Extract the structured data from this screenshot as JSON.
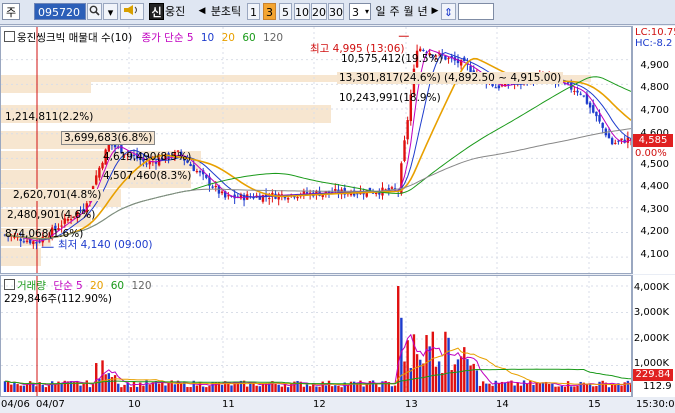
{
  "toolbar": {
    "market_select": "주",
    "stock_code": "095720",
    "stock_name": "웅진",
    "new_label": "신",
    "prev_label": "◀",
    "interval_label": "분초틱",
    "interval_options": [
      "1",
      "3",
      "5",
      "10",
      "20",
      "30"
    ],
    "selected_interval": "3",
    "count_value": "3",
    "period_labels": [
      "일",
      "주",
      "월",
      "년"
    ],
    "next_label": "▶",
    "spin_label": "⇕"
  },
  "price_panel": {
    "legend": {
      "title": "웅진씽크빅 매물대 수(10)",
      "ma_label": "종가 단순",
      "ma_periods": [
        "5",
        "10",
        "20",
        "60",
        "120"
      ],
      "ma_colors": [
        "#c000c0",
        "#1e3ccd",
        "#e8a000",
        "#1a9a1a",
        "#666666"
      ]
    },
    "lc_label": "LC:10.75",
    "hc_label": "HC:-8.2",
    "current_price": "4,585",
    "change_pct": "0.00%",
    "price_axis": [
      "4,900",
      "4,800",
      "4,700",
      "4,600",
      "4,500",
      "4,400",
      "4,300",
      "4,200",
      "4,100"
    ],
    "volume_profile": [
      {
        "text": "10,575,412(19.5%)"
      },
      {
        "text": "13,301,817(24.6%) (4,892.50 ~ 4,915.00)"
      },
      {
        "text": "10,243,991(18.9%)"
      },
      {
        "text": "1,214,811(2.2%)"
      },
      {
        "text": "3,699,683(6.8%)"
      },
      {
        "text": "4,619,490(8.5%)"
      },
      {
        "text": "4,507,460(8.3%)"
      },
      {
        "text": "2,620,701(4.8%)"
      },
      {
        "text": "2,480,901(4.6%)"
      },
      {
        "text": "874,068(1.6%)"
      }
    ],
    "high_label": "최고 4,995 (13:06)",
    "low_label": "최저 4,140 (09:00)"
  },
  "volume_panel": {
    "legend": {
      "title": "거래량",
      "ma_label": "단순",
      "ma_periods": [
        "5",
        "20",
        "60",
        "120"
      ],
      "ma_colors": [
        "#c000c0",
        "#e8a000",
        "#1a9a1a",
        "#666666"
      ]
    },
    "info": "229,846주(112.90%)",
    "volume_axis": [
      "4,000K",
      "3,000K",
      "2,000K",
      "1,000K"
    ],
    "current_volume": "229.84",
    "volume_pct": "112.9"
  },
  "x_axis": {
    "start_label": "04/06",
    "ticks": [
      "04/07",
      "10",
      "11",
      "12",
      "13",
      "14",
      "15"
    ],
    "end_time": "15:30:0"
  },
  "chart_data": {
    "type": "candlestick",
    "price_range": [
      4060,
      5000
    ],
    "x_labels": [
      "04/06",
      "04/07",
      "10",
      "11",
      "12",
      "13",
      "14",
      "15"
    ],
    "high": {
      "price": 4995,
      "time": "13:06"
    },
    "low": {
      "price": 4140,
      "time": "09:00"
    },
    "last_close": 4585,
    "volume_max_k": 4000
  }
}
